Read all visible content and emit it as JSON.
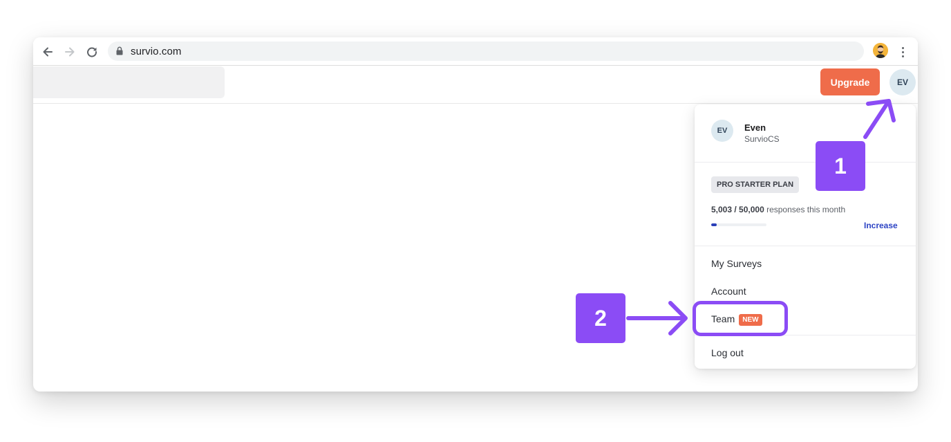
{
  "browser": {
    "url": "survio.com",
    "icons": [
      "back-arrow-icon",
      "forward-arrow-icon",
      "reload-icon",
      "lock-icon",
      "profile-avatar-icon",
      "more-vert-icon"
    ]
  },
  "header": {
    "upgrade_label": "Upgrade",
    "avatar_initials": "EV"
  },
  "dropdown": {
    "user": {
      "initials": "EV",
      "name": "Even",
      "organization": "SurvioCS"
    },
    "plan": {
      "badge": "PRO STARTER PLAN",
      "responses_used": "5,003",
      "responses_limit": "50,000",
      "responses_separator": " / ",
      "responses_suffix": " responses this month",
      "progress_fraction": 0.1,
      "increase_label": "Increase"
    },
    "menu": {
      "my_surveys": "My Surveys",
      "account": "Account",
      "team": "Team",
      "team_badge": "NEW",
      "logout": "Log out"
    }
  },
  "annotations": {
    "step1": "1",
    "step2": "2",
    "color": "#8b4cf5"
  },
  "colors": {
    "accent_orange": "#ef6c4a",
    "link_blue": "#2c43c4",
    "callout_purple": "#8b4cf5"
  }
}
